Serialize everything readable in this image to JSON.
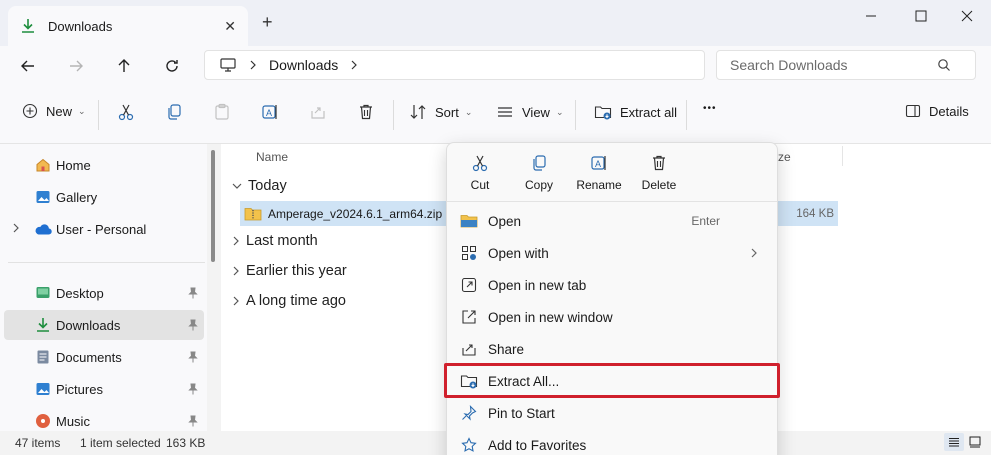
{
  "window": {
    "tab_title": "Downloads",
    "new_tab": "+"
  },
  "address": {
    "crumb": "Downloads",
    "search_placeholder": "Search Downloads"
  },
  "toolbar": {
    "new_label": "New",
    "sort_label": "Sort",
    "view_label": "View",
    "extract_all_label": "Extract all",
    "more_label": "•••",
    "details_label": "Details"
  },
  "sidebar": {
    "items": [
      {
        "label": "Home"
      },
      {
        "label": "Gallery"
      },
      {
        "label": "User - Personal"
      },
      {
        "label": "Desktop"
      },
      {
        "label": "Downloads"
      },
      {
        "label": "Documents"
      },
      {
        "label": "Pictures"
      },
      {
        "label": "Music"
      }
    ]
  },
  "content": {
    "col_name": "Name",
    "col_size": "ze",
    "groups": [
      {
        "label": "Today"
      },
      {
        "label": "Last month"
      },
      {
        "label": "Earlier this year"
      },
      {
        "label": "A long time ago"
      }
    ],
    "file": {
      "name": "Amperage_v2024.6.1_arm64.zip",
      "size": "164 KB"
    }
  },
  "status": {
    "items": "47 items",
    "selected": "1 item selected",
    "size": "163 KB"
  },
  "context_menu": {
    "quick_actions": [
      {
        "label": "Cut"
      },
      {
        "label": "Copy"
      },
      {
        "label": "Rename"
      },
      {
        "label": "Delete"
      }
    ],
    "items": [
      {
        "label": "Open",
        "shortcut": "Enter"
      },
      {
        "label": "Open with"
      },
      {
        "label": "Open in new tab"
      },
      {
        "label": "Open in new window"
      },
      {
        "label": "Share"
      },
      {
        "label": "Extract All..."
      },
      {
        "label": "Pin to Start"
      },
      {
        "label": "Add to Favorites"
      }
    ]
  },
  "colors": {
    "accent": "#0067c0",
    "highlight": "#d0202d",
    "selection": "#cfe3f5"
  }
}
